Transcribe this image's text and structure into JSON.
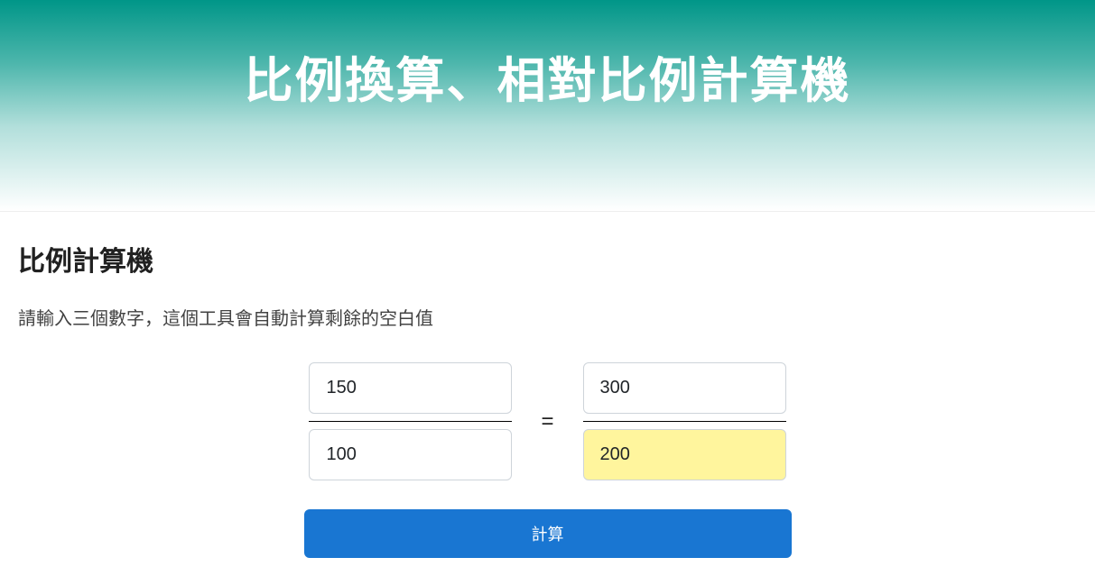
{
  "header": {
    "title": "比例換算、相對比例計算機"
  },
  "main": {
    "section_title": "比例計算機",
    "section_desc": "請輸入三個數字，這個工具會自動計算剩餘的空白值",
    "inputs": {
      "a": "150",
      "b": "100",
      "c": "300",
      "d": "200"
    },
    "equals_symbol": "=",
    "calculate_button": "計算"
  }
}
